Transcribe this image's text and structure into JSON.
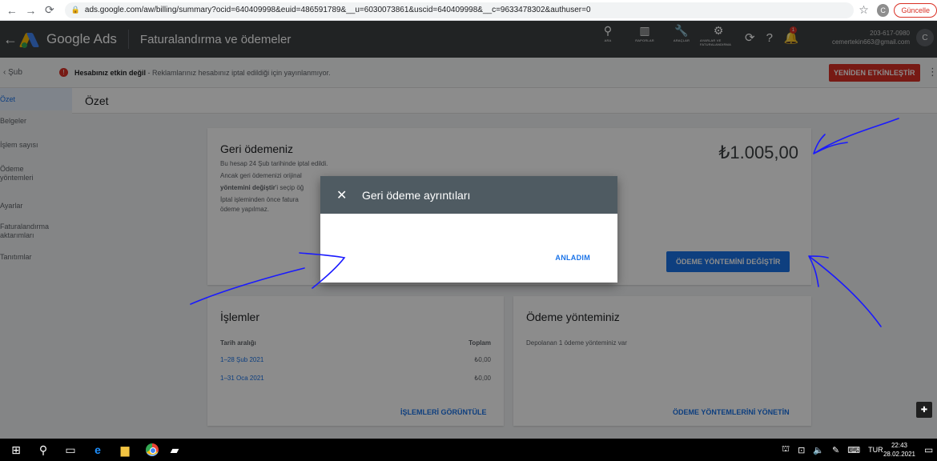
{
  "browser": {
    "url": "ads.google.com/aw/billing/summary?ocid=640409998&euid=486591789&__u=6030073861&uscid=640409998&__c=9633478302&authuser=0",
    "profile_initial": "C",
    "update_label": "Güncelle"
  },
  "header": {
    "app_name": "Google Ads",
    "page_title": "Faturalandırma ve ödemeler",
    "tools": [
      {
        "label": "ARA",
        "icon": "search-icon"
      },
      {
        "label": "RAPORLAR",
        "icon": "reports-icon"
      },
      {
        "label": "ARAÇLAR",
        "icon": "wrench-icon"
      },
      {
        "label": "AYARLAR VE FATURALANDIRMA",
        "icon": "gear-icon"
      }
    ],
    "bell_count": "1",
    "account_id": "203-617-0980",
    "account_email": "cemertekin663@gmail.com",
    "avatar_initial": "C"
  },
  "alert": {
    "breadcrumb": "Şub",
    "title": "Hesabınız etkin değil",
    "text": " - Reklamlarınız hesabınız iptal edildiği için yayınlanmıyor.",
    "reactivate_label": "YENİDEN ETKİNLEŞTİR"
  },
  "sidebar": {
    "items": [
      "Özet",
      "Belgeler",
      "İşlem sayısı",
      "Ödeme yöntemleri",
      "Ayarlar",
      "Faturalandırma aktarımları",
      "Tanıtımlar"
    ]
  },
  "summary_title": "Özet",
  "refund": {
    "title": "Geri ödemeniz",
    "amount": "₺1.005,00",
    "line1": "Bu hesap 24 Şub tarihinde iptal edildi.",
    "line2": "Ancak geri ödemenizi orijinal",
    "line3_bold": "yöntemini değiştir",
    "line3_rest": "'i seçip öğ",
    "line4": "İptal işleminden önce fatura",
    "line5": "ödeme yapılmaz.",
    "button_label": "ÖDEME YÖNTEMİNİ DEĞİŞTİR"
  },
  "transactions": {
    "title": "İşlemler",
    "col_date": "Tarih aralığı",
    "col_total": "Toplam",
    "rows": [
      {
        "range": "1–28 Şub 2021",
        "total": "₺0,00"
      },
      {
        "range": "1–31 Oca 2021",
        "total": "₺0,00"
      }
    ],
    "view_label": "İŞLEMLERİ GÖRÜNTÜLE"
  },
  "payment": {
    "title": "Ödeme yönteminiz",
    "saved": "Depolanan 1 ödeme yönteminiz var",
    "manage_label": "ÖDEME YÖNTEMLERİNİ YÖNETİN"
  },
  "dialog": {
    "title": "Geri ödeme ayrıntıları",
    "ok_label": "ANLADIM"
  },
  "taskbar": {
    "lang": "TUR",
    "time": "22:43",
    "date": "28.02.2021"
  },
  "colors": {
    "accent": "#1a73e8",
    "alert": "#d93025",
    "dialog_header": "#4f5b62",
    "annotation_ink": "#1a1aff"
  }
}
